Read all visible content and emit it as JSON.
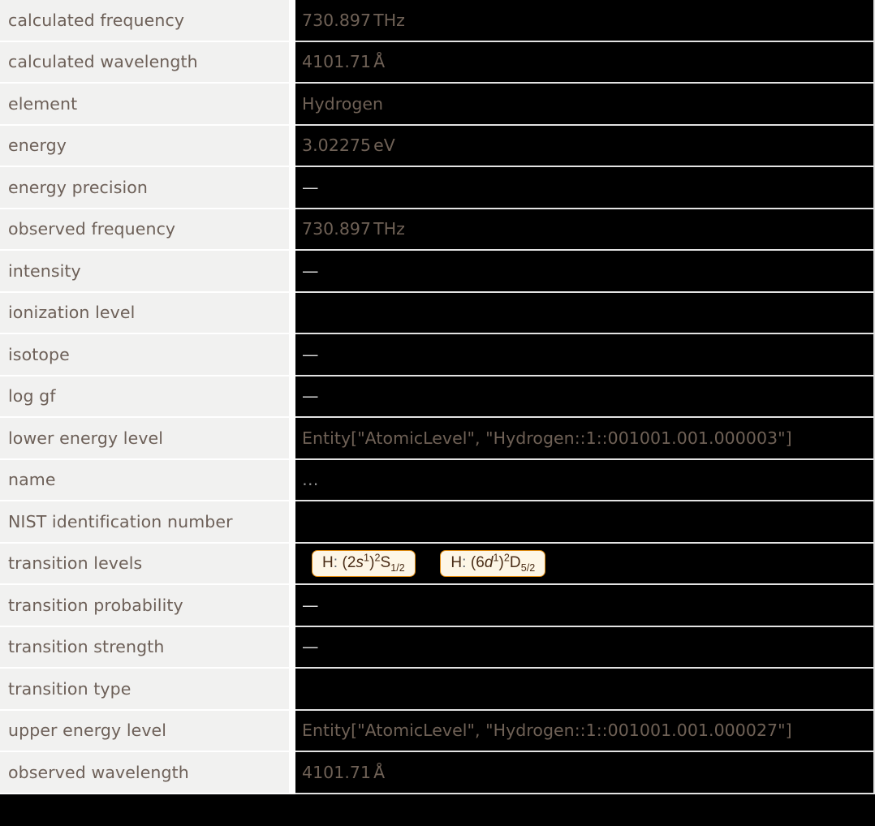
{
  "table": {
    "name": "spectral-line-properties",
    "rows": [
      {
        "label": "calculated frequency",
        "value": "730.897",
        "unit": "THz",
        "kind": "quantity"
      },
      {
        "label": "calculated wavelength",
        "value": "4101.71",
        "unit": "Å",
        "kind": "quantity"
      },
      {
        "label": "element",
        "value": "Hydrogen",
        "unit": "",
        "kind": "text"
      },
      {
        "label": "energy",
        "value": "3.02275",
        "unit": "eV",
        "kind": "quantity"
      },
      {
        "label": "energy precision",
        "value": "—",
        "unit": "",
        "kind": "missing"
      },
      {
        "label": "observed frequency",
        "value": "730.897",
        "unit": "THz",
        "kind": "quantity"
      },
      {
        "label": "intensity",
        "value": "—",
        "unit": "",
        "kind": "missing"
      },
      {
        "label": "ionization level",
        "value": "",
        "unit": "",
        "kind": "empty"
      },
      {
        "label": "isotope",
        "value": "—",
        "unit": "",
        "kind": "missing"
      },
      {
        "label": "log gf",
        "value": "—",
        "unit": "",
        "kind": "missing"
      },
      {
        "label": "lower energy level",
        "value": "Entity[\"AtomicLevel\", \"Hydrogen::1::001001.001.000003\"]",
        "unit": "",
        "kind": "entity"
      },
      {
        "label": "name",
        "value": "…",
        "unit": "",
        "kind": "ellipsis"
      },
      {
        "label": "NIST identification number",
        "value": "",
        "unit": "",
        "kind": "empty"
      },
      {
        "label": "transition levels",
        "value": "",
        "unit": "",
        "kind": "chips"
      },
      {
        "label": "transition probability",
        "value": "—",
        "unit": "",
        "kind": "missing"
      },
      {
        "label": "transition strength",
        "value": "—",
        "unit": "",
        "kind": "missing"
      },
      {
        "label": "transition type",
        "value": "",
        "unit": "",
        "kind": "empty"
      },
      {
        "label": "upper energy level",
        "value": "Entity[\"AtomicLevel\", \"Hydrogen::1::001001.001.000027\"]",
        "unit": "",
        "kind": "entity"
      },
      {
        "label": "observed wavelength",
        "value": "4101.71",
        "unit": "Å",
        "kind": "quantity"
      }
    ]
  },
  "transition_levels": {
    "chips": [
      {
        "label": "H: (2s1)2S1/2",
        "element": "H",
        "colon": ":",
        "config_open": "(2",
        "orbital": "s",
        "orbital_exp": "1",
        "config_close": ")",
        "multiplicity": "2",
        "term": "S",
        "j": "1/2"
      },
      {
        "label": "H: (6d1)2D5/2",
        "element": "H",
        "colon": ":",
        "config_open": "(6",
        "orbital": "d",
        "orbital_exp": "1",
        "config_close": ")",
        "multiplicity": "2",
        "term": "D",
        "j": "5/2"
      }
    ]
  },
  "colors": {
    "label_background": "#f1f1f0",
    "label_text": "#6d6058",
    "value_background": "#000000",
    "value_text": "#6f6156",
    "missing_dash": "#d9d9d9",
    "chip_background": "#fdf6e6",
    "chip_border": "#e08b10",
    "chip_text": "#4a2d17",
    "grid_line": "#e3e3e3",
    "page_background": "#000000"
  }
}
